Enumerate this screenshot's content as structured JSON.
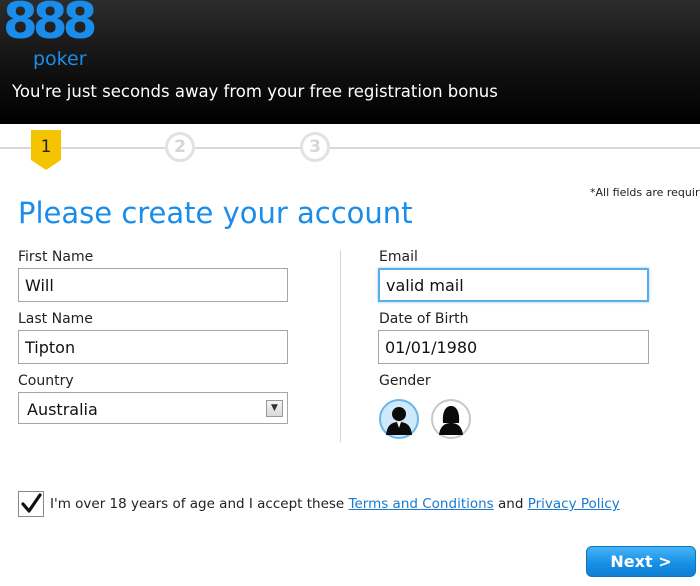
{
  "brand": {
    "logo_digits": "888",
    "logo_word": "poker",
    "color": "#1a8dea"
  },
  "header": {
    "tagline": "You're just seconds away from your free registration bonus"
  },
  "stepper": {
    "steps": [
      "1",
      "2",
      "3"
    ],
    "current": 1
  },
  "form": {
    "required_note": "*All fields are require",
    "title": "Please create your account",
    "first_name": {
      "label": "First Name",
      "value": "Will"
    },
    "last_name": {
      "label": "Last Name",
      "value": "Tipton"
    },
    "country": {
      "label": "Country",
      "value": "Australia"
    },
    "email": {
      "label": "Email",
      "value": "valid mail"
    },
    "dob": {
      "label": "Date of Birth",
      "value": "01/01/1980"
    },
    "gender": {
      "label": "Gender",
      "selected": "male"
    },
    "consent": {
      "checked": true,
      "prefix": "I'm over 18 years of age and I accept these",
      "terms_link": "Terms and Conditions",
      "and": "and",
      "privacy_link": "Privacy Policy"
    },
    "next_label": "Next >"
  },
  "colors": {
    "accent": "#1a8dea",
    "focus_border": "#58aee8",
    "header_bg": "#000000"
  }
}
